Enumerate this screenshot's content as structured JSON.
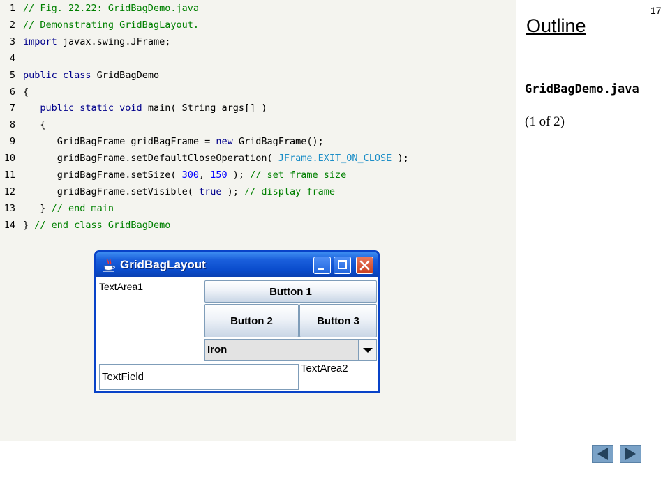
{
  "code": {
    "lines": [
      {
        "num": "1",
        "parts": [
          {
            "t": "// Fig. 22.22: GridBagDemo.java",
            "c": "cm"
          }
        ]
      },
      {
        "num": "2",
        "parts": [
          {
            "t": "// Demonstrating GridBagLayout.",
            "c": "cm"
          }
        ]
      },
      {
        "num": "3",
        "parts": [
          {
            "t": "import",
            "c": "kw"
          },
          {
            "t": " javax.swing.JFrame;",
            "c": ""
          }
        ]
      },
      {
        "num": "4",
        "parts": []
      },
      {
        "num": "5",
        "parts": [
          {
            "t": "public class",
            "c": "kw"
          },
          {
            "t": " GridBagDemo",
            "c": ""
          }
        ]
      },
      {
        "num": "6",
        "parts": [
          {
            "t": "{",
            "c": ""
          }
        ]
      },
      {
        "num": "7",
        "parts": [
          {
            "t": "   ",
            "c": ""
          },
          {
            "t": "public static void",
            "c": "kw"
          },
          {
            "t": " main( String args[] )",
            "c": ""
          }
        ]
      },
      {
        "num": "8",
        "parts": [
          {
            "t": "   {",
            "c": ""
          }
        ]
      },
      {
        "num": "9",
        "parts": [
          {
            "t": "      GridBagFrame gridBagFrame = ",
            "c": ""
          },
          {
            "t": "new",
            "c": "kw"
          },
          {
            "t": " GridBagFrame();",
            "c": ""
          }
        ]
      },
      {
        "num": "10",
        "parts": [
          {
            "t": "      gridBagFrame.setDefaultCloseOperation( ",
            "c": ""
          },
          {
            "t": "JFrame.EXIT_ON_CLOSE",
            "c": "const"
          },
          {
            "t": " );",
            "c": ""
          }
        ]
      },
      {
        "num": "11",
        "parts": [
          {
            "t": "      gridBagFrame.setSize( ",
            "c": ""
          },
          {
            "t": "300",
            "c": "lit"
          },
          {
            "t": ", ",
            "c": ""
          },
          {
            "t": "150",
            "c": "lit"
          },
          {
            "t": " ); ",
            "c": ""
          },
          {
            "t": "// set frame size",
            "c": "cm"
          }
        ]
      },
      {
        "num": "12",
        "parts": [
          {
            "t": "      gridBagFrame.setVisible( ",
            "c": ""
          },
          {
            "t": "true",
            "c": "kw"
          },
          {
            "t": " ); ",
            "c": ""
          },
          {
            "t": "// display frame",
            "c": "cm"
          }
        ]
      },
      {
        "num": "13",
        "parts": [
          {
            "t": "   } ",
            "c": ""
          },
          {
            "t": "// end main",
            "c": "cm"
          }
        ]
      },
      {
        "num": "14",
        "parts": [
          {
            "t": "} ",
            "c": ""
          },
          {
            "t": "// end class GridBagDemo",
            "c": "cm"
          }
        ]
      }
    ]
  },
  "slide": {
    "page_number": "17",
    "outline_heading": "Outline",
    "file_name": "GridBagDemo.java",
    "page_count": "(1 of 2)",
    "nav_prev_icon": "triangle-left-icon",
    "nav_next_icon": "triangle-right-icon"
  },
  "window": {
    "title": "GridBagLayout",
    "icon": "java-cup-icon",
    "components": {
      "text_area_1": "TextArea1",
      "button_1": "Button 1",
      "button_2": "Button 2",
      "button_3": "Button 3",
      "combo_value": "Iron",
      "text_field": "TextField",
      "text_area_2": "TextArea2"
    }
  }
}
